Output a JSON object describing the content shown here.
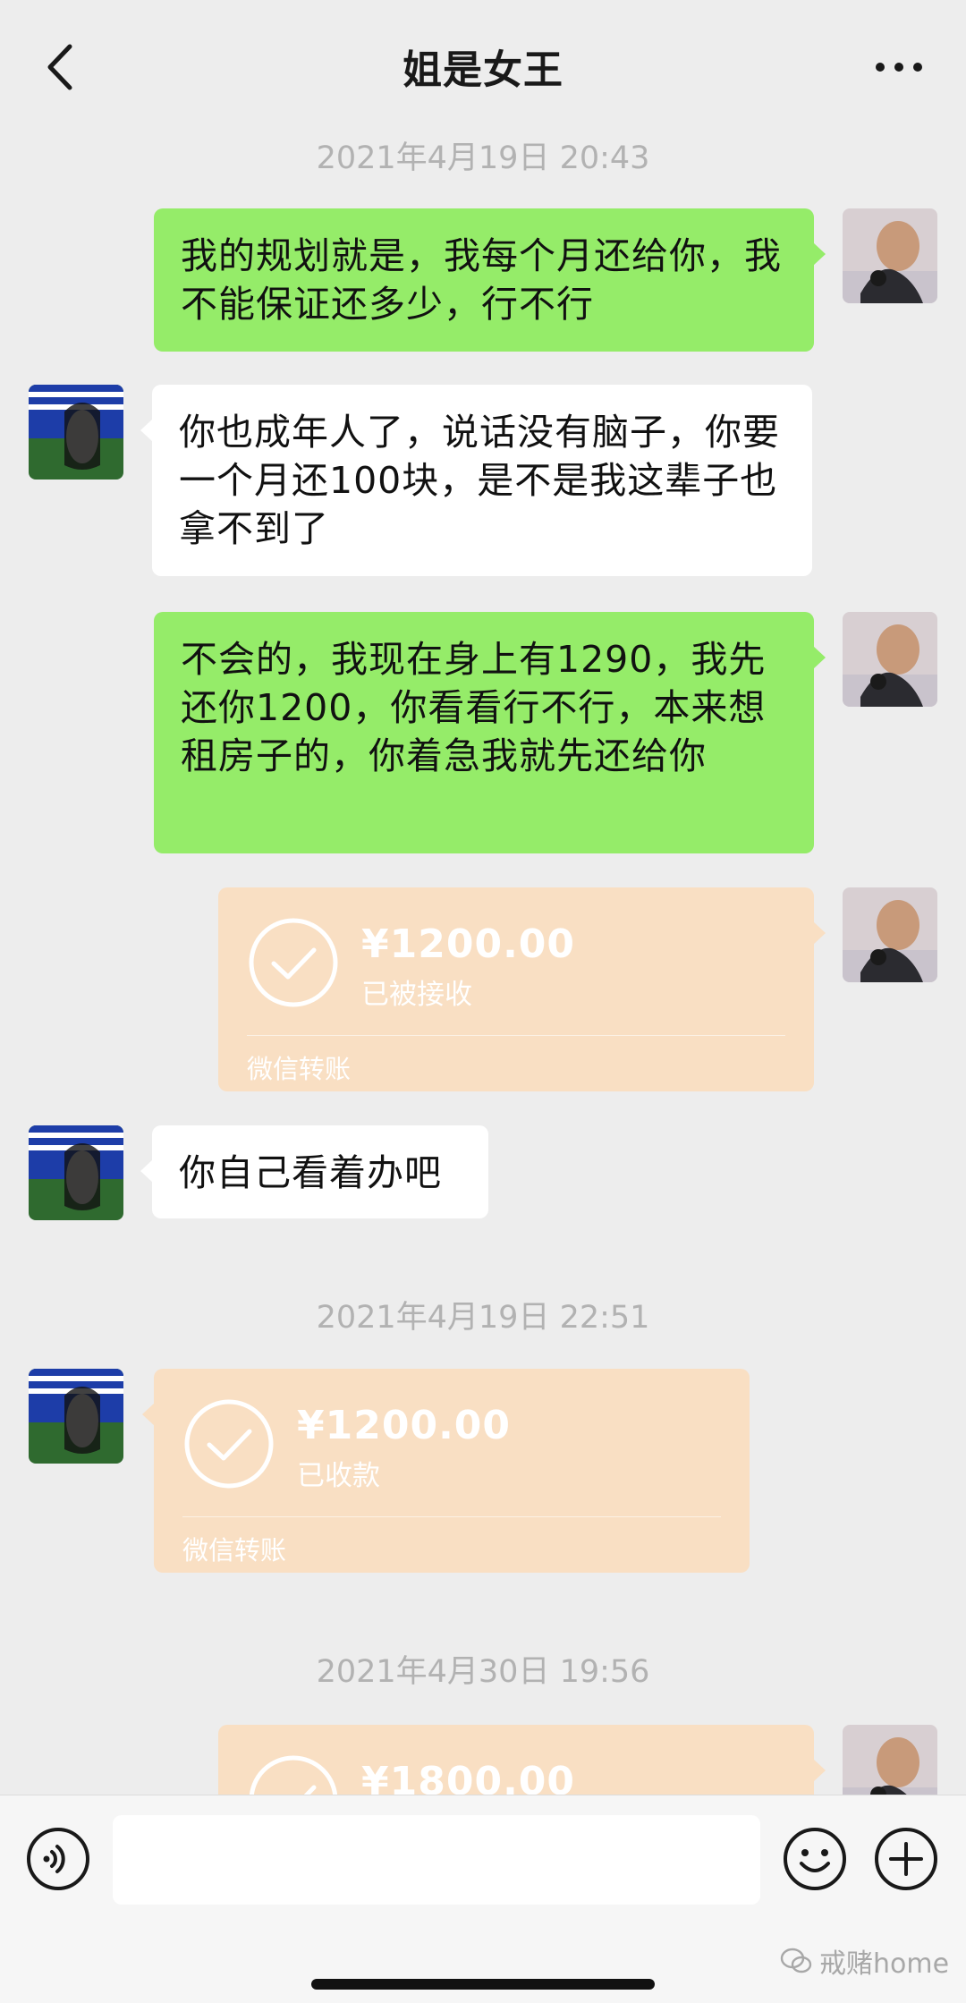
{
  "header": {
    "title": "姐是女王"
  },
  "messages": {
    "t1": "2021年4月19日 20:43",
    "m1": "我的规划就是，我每个月还给你，我不能保证还多少，行不行",
    "m2": "你也成年人了，说话没有脑子，你要一个月还100块，是不是我这辈子也拿不到了",
    "m3": "不会的，我现在身上有1290，我先还你1200，你看看行不行，本来想租房子的，你着急我就先还给你",
    "tr1": {
      "amount": "¥1200.00",
      "status": "已被接收",
      "label": "微信转账"
    },
    "m4": "你自己看着办吧",
    "t2": "2021年4月19日 22:51",
    "tr2": {
      "amount": "¥1200.00",
      "status": "已收款",
      "label": "微信转账"
    },
    "t3": "2021年4月30日 19:56",
    "tr3": {
      "amount": "¥1800.00"
    }
  },
  "watermark": "戒赌home",
  "colors": {
    "my_bubble": "#95ec69",
    "other_bubble": "#ffffff",
    "transfer": "#f9dfc3",
    "background": "#ededed"
  }
}
